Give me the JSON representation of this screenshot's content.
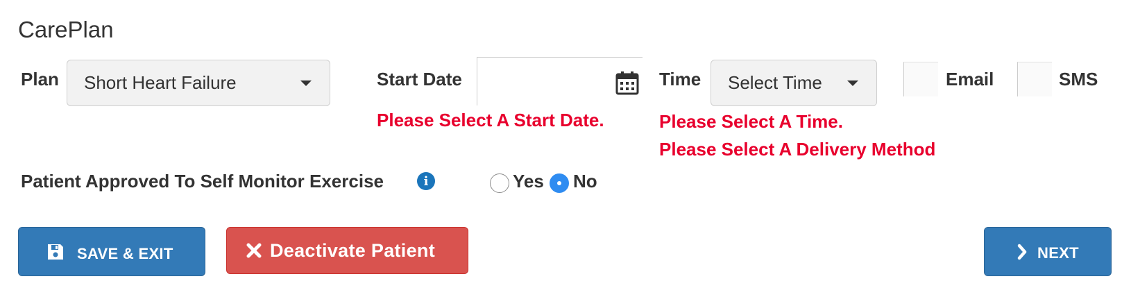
{
  "title": "CarePlan",
  "plan": {
    "label": "Plan",
    "selected": "Short Heart Failure"
  },
  "start_date": {
    "label": "Start Date",
    "value": "",
    "error": "Please Select A Start Date.",
    "icon": "calendar-icon"
  },
  "time": {
    "label": "Time",
    "selected": "Select Time",
    "error_time": "Please Select A Time.",
    "error_delivery": "Please Select A Delivery Method"
  },
  "delivery": {
    "email_label": "Email",
    "sms_label": "SMS",
    "email_checked": false,
    "sms_checked": false
  },
  "self_monitor": {
    "label": "Patient Approved To Self Monitor Exercise",
    "info_icon": "info-icon",
    "info_glyph": "i",
    "yes_label": "Yes",
    "no_label": "No",
    "selected": "No"
  },
  "actions": {
    "save_exit_label": "SAVE & EXIT",
    "deactivate_label": "Deactivate Patient",
    "next_label": "NEXT"
  },
  "colors": {
    "primary": "#337ab7",
    "danger": "#d9534f",
    "error_text": "#e8002d",
    "radio_selected": "#2f8cf1"
  }
}
